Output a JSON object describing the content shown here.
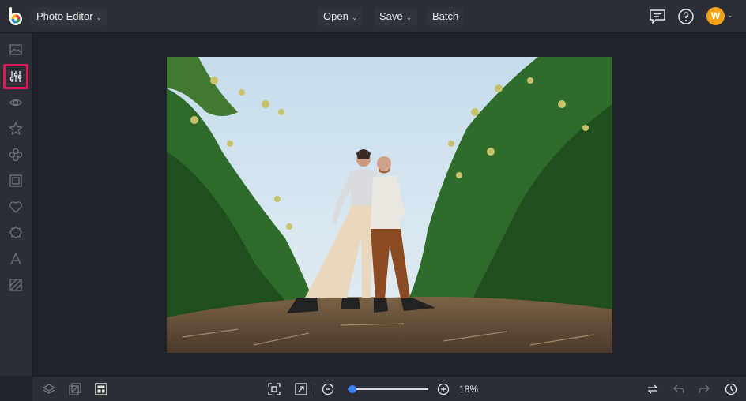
{
  "header": {
    "app_menu_label": "Photo Editor",
    "open_label": "Open",
    "save_label": "Save",
    "batch_label": "Batch",
    "avatar_initial": "W"
  },
  "sidebar": {
    "items": [
      {
        "name": "image-icon"
      },
      {
        "name": "adjustments-icon",
        "active": true
      },
      {
        "name": "eye-icon"
      },
      {
        "name": "star-icon"
      },
      {
        "name": "overlays-icon"
      },
      {
        "name": "frame-icon"
      },
      {
        "name": "heart-icon"
      },
      {
        "name": "badge-icon"
      },
      {
        "name": "text-icon"
      },
      {
        "name": "texture-icon"
      }
    ]
  },
  "footer": {
    "zoom_level": "18%",
    "zoom_fraction": 0.18
  },
  "colors": {
    "accent_active": "#e0165b",
    "slider": "#3b82f6",
    "avatar": "#f7a21b"
  }
}
